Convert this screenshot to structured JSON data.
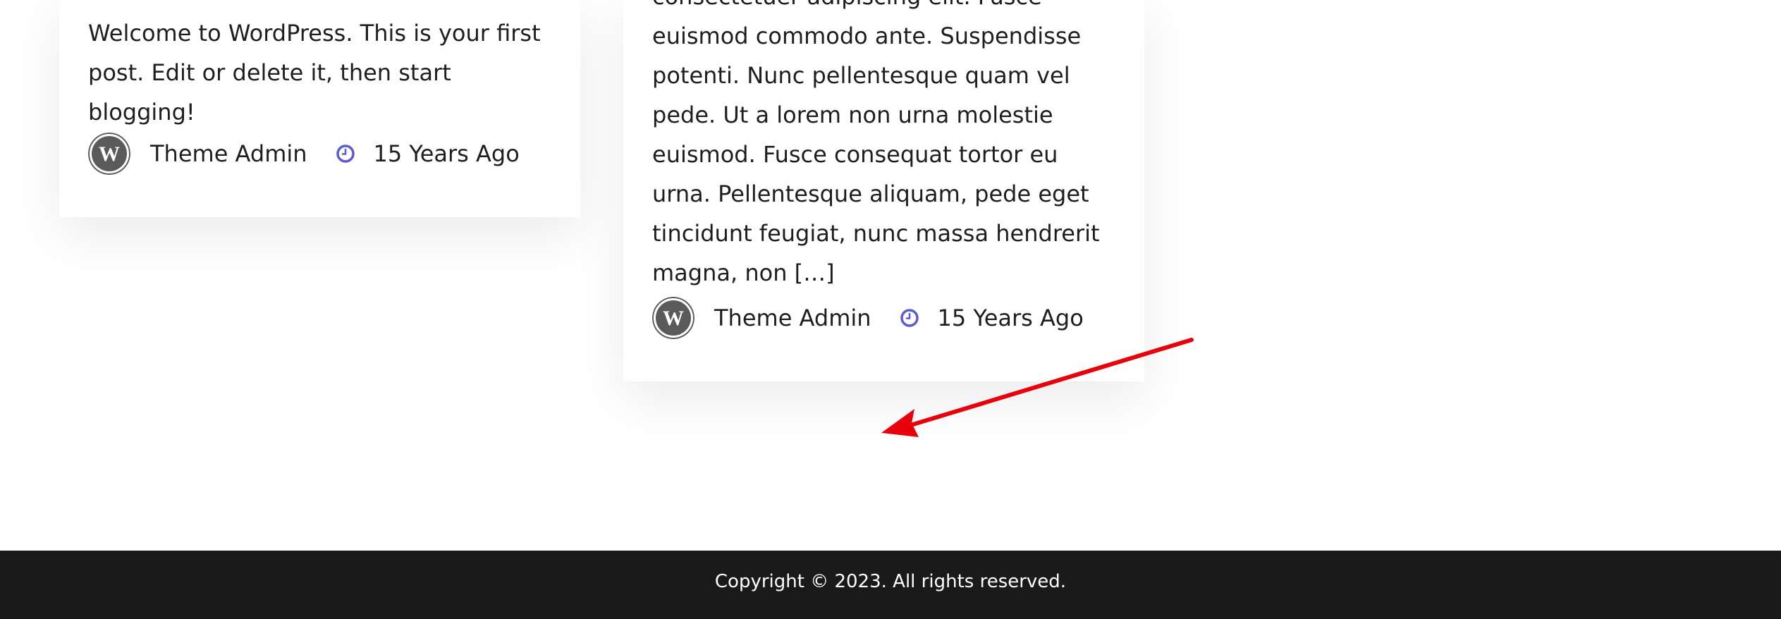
{
  "posts": [
    {
      "excerpt": "Welcome to WordPress. This is your first post. Edit or delete it, then start blogging!",
      "author": "Theme Admin",
      "date": "15 Years Ago"
    },
    {
      "excerpt": "consectetuer adipiscing elit. Fusce euismod commodo ante. Suspendisse potenti. Nunc pellentesque quam vel pede. Ut a lorem non urna molestie euismod. Fusce consequat tortor eu urna. Pellentesque aliquam, pede eget tincidunt feugiat, nunc massa hendrerit magna, non […]",
      "author": "Theme Admin",
      "date": "15 Years Ago"
    }
  ],
  "icons": {
    "avatar": "wordpress-logo-icon",
    "date": "clock-icon"
  },
  "colors": {
    "footer_background": "#1a1a1a",
    "clock_icon": "#5b5bd6",
    "annotation_arrow": "#e8000b"
  },
  "footer": {
    "copyright": "Copyright © 2023. All rights reserved."
  }
}
